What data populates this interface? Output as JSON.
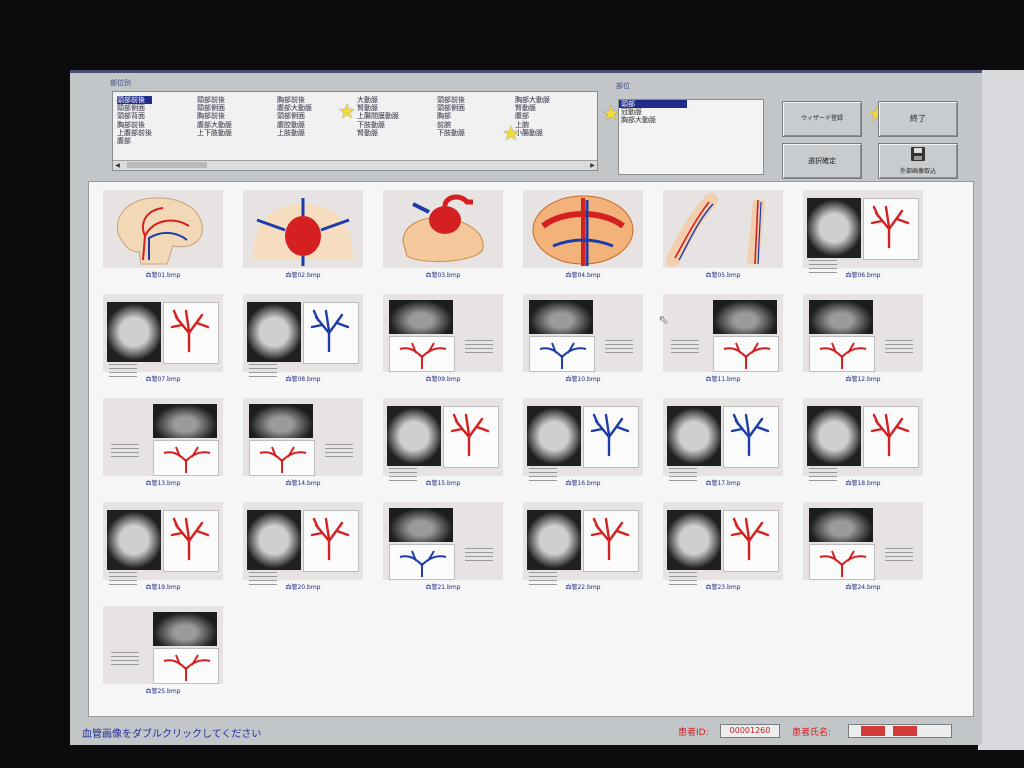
{
  "header": {
    "category_group_label": "部位別",
    "selected_group_label": "部位"
  },
  "category_list": {
    "columns": [
      [
        "頭部前後",
        "頸部側面",
        "頭部背面",
        "胸部前後",
        "上腹部前後",
        "腹部"
      ],
      [
        "頸部前後",
        "頸部側面",
        "胸部前後",
        "腹部大動脈",
        "上下肢動脈"
      ],
      [
        "胸部前後",
        "腹部大動脈",
        "頭部側面",
        "腹腔動脈",
        "上肢動脈"
      ],
      [
        "大動脈",
        "腎動脈",
        "上腸間膜動脈",
        "下肢動脈",
        "腎動脈"
      ],
      [
        "頭部前後",
        "頭部側面",
        "胸部",
        "前腕",
        "下肢動脈"
      ],
      [
        "胸部大動脈",
        "腎動脈",
        "腹部",
        "上腕",
        "小腸動脈"
      ]
    ],
    "selected_item": "頭部前後"
  },
  "selected_list": {
    "items": [
      "頭部",
      "冠動脈",
      "胸部大動脈"
    ]
  },
  "buttons": {
    "btn1": "ウィザード登録",
    "exit": "終了",
    "btn3": "選択確定",
    "btn4": "外部画像取込"
  },
  "thumbnails": [
    {
      "caption": "血管01.bmp",
      "kind": "head"
    },
    {
      "caption": "血管02.bmp",
      "kind": "heart-torso"
    },
    {
      "caption": "血管03.bmp",
      "kind": "heart"
    },
    {
      "caption": "血管04.bmp",
      "kind": "abdomen"
    },
    {
      "caption": "血管05.bmp",
      "kind": "limbs"
    },
    {
      "caption": "血管06.bmp",
      "kind": "xray-left"
    },
    {
      "caption": "血管07.bmp",
      "kind": "xray-left"
    },
    {
      "caption": "血管08.bmp",
      "kind": "xray-left-blue"
    },
    {
      "caption": "血管09.bmp",
      "kind": "xray-top"
    },
    {
      "caption": "血管10.bmp",
      "kind": "xray-top-blue"
    },
    {
      "caption": "血管11.bmp",
      "kind": "xray-top-right"
    },
    {
      "caption": "血管12.bmp",
      "kind": "xray-top"
    },
    {
      "caption": "血管13.bmp",
      "kind": "xray-top-right"
    },
    {
      "caption": "血管14.bmp",
      "kind": "xray-top"
    },
    {
      "caption": "血管15.bmp",
      "kind": "xray-left"
    },
    {
      "caption": "血管16.bmp",
      "kind": "xray-left-blue"
    },
    {
      "caption": "血管17.bmp",
      "kind": "xray-left-blue"
    },
    {
      "caption": "血管18.bmp",
      "kind": "xray-left"
    },
    {
      "caption": "血管19.bmp",
      "kind": "xray-left"
    },
    {
      "caption": "血管20.bmp",
      "kind": "xray-left"
    },
    {
      "caption": "血管21.bmp",
      "kind": "xray-top-blue"
    },
    {
      "caption": "血管22.bmp",
      "kind": "xray-left"
    },
    {
      "caption": "血管23.bmp",
      "kind": "xray-left"
    },
    {
      "caption": "血管24.bmp",
      "kind": "xray-top"
    },
    {
      "caption": "血管25.bmp",
      "kind": "xray-top-right"
    }
  ],
  "status": {
    "message": "血管画像をダブルクリックしてください",
    "patient_id_label": "患者ID:",
    "patient_id_value": "00001260",
    "patient_name_label": "患者氏名:"
  },
  "colors": {
    "selection": "#1f2c8a",
    "artery": "#d42020",
    "vein": "#1c3ca8",
    "caption": "#1e2a80"
  }
}
